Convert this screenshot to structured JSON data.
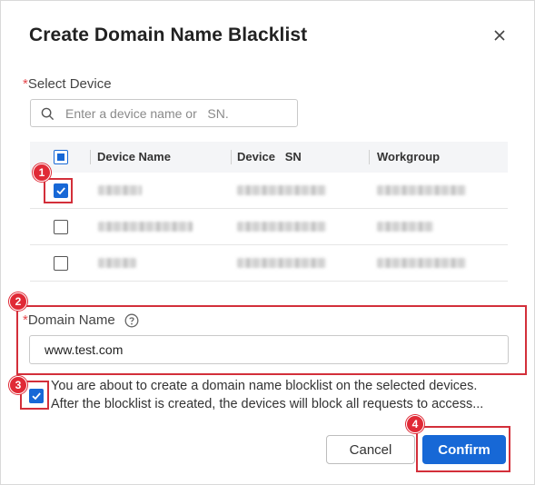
{
  "dialog": {
    "title": "Create Domain Name Blacklist"
  },
  "select_device": {
    "required_mark": "*",
    "label": "Select Device",
    "search_placeholder": "Enter a device name or   SN."
  },
  "table": {
    "columns": [
      "Device Name",
      "Device   SN",
      "Workgroup"
    ],
    "rows": [
      {
        "checked": true
      },
      {
        "checked": false
      },
      {
        "checked": false
      }
    ]
  },
  "domain": {
    "required_mark": "*",
    "label": "Domain Name",
    "value": "www.test.com"
  },
  "notice": {
    "checked": true,
    "line1": "You are about to create a domain name blocklist on the selected devices.",
    "line2": "After the blocklist is created, the devices will block all requests to access..."
  },
  "buttons": {
    "cancel": "Cancel",
    "confirm": "Confirm"
  },
  "annotations": [
    "1",
    "2",
    "3",
    "4"
  ],
  "colors": {
    "accent": "#1768d6",
    "annotation": "#d32f3a"
  }
}
